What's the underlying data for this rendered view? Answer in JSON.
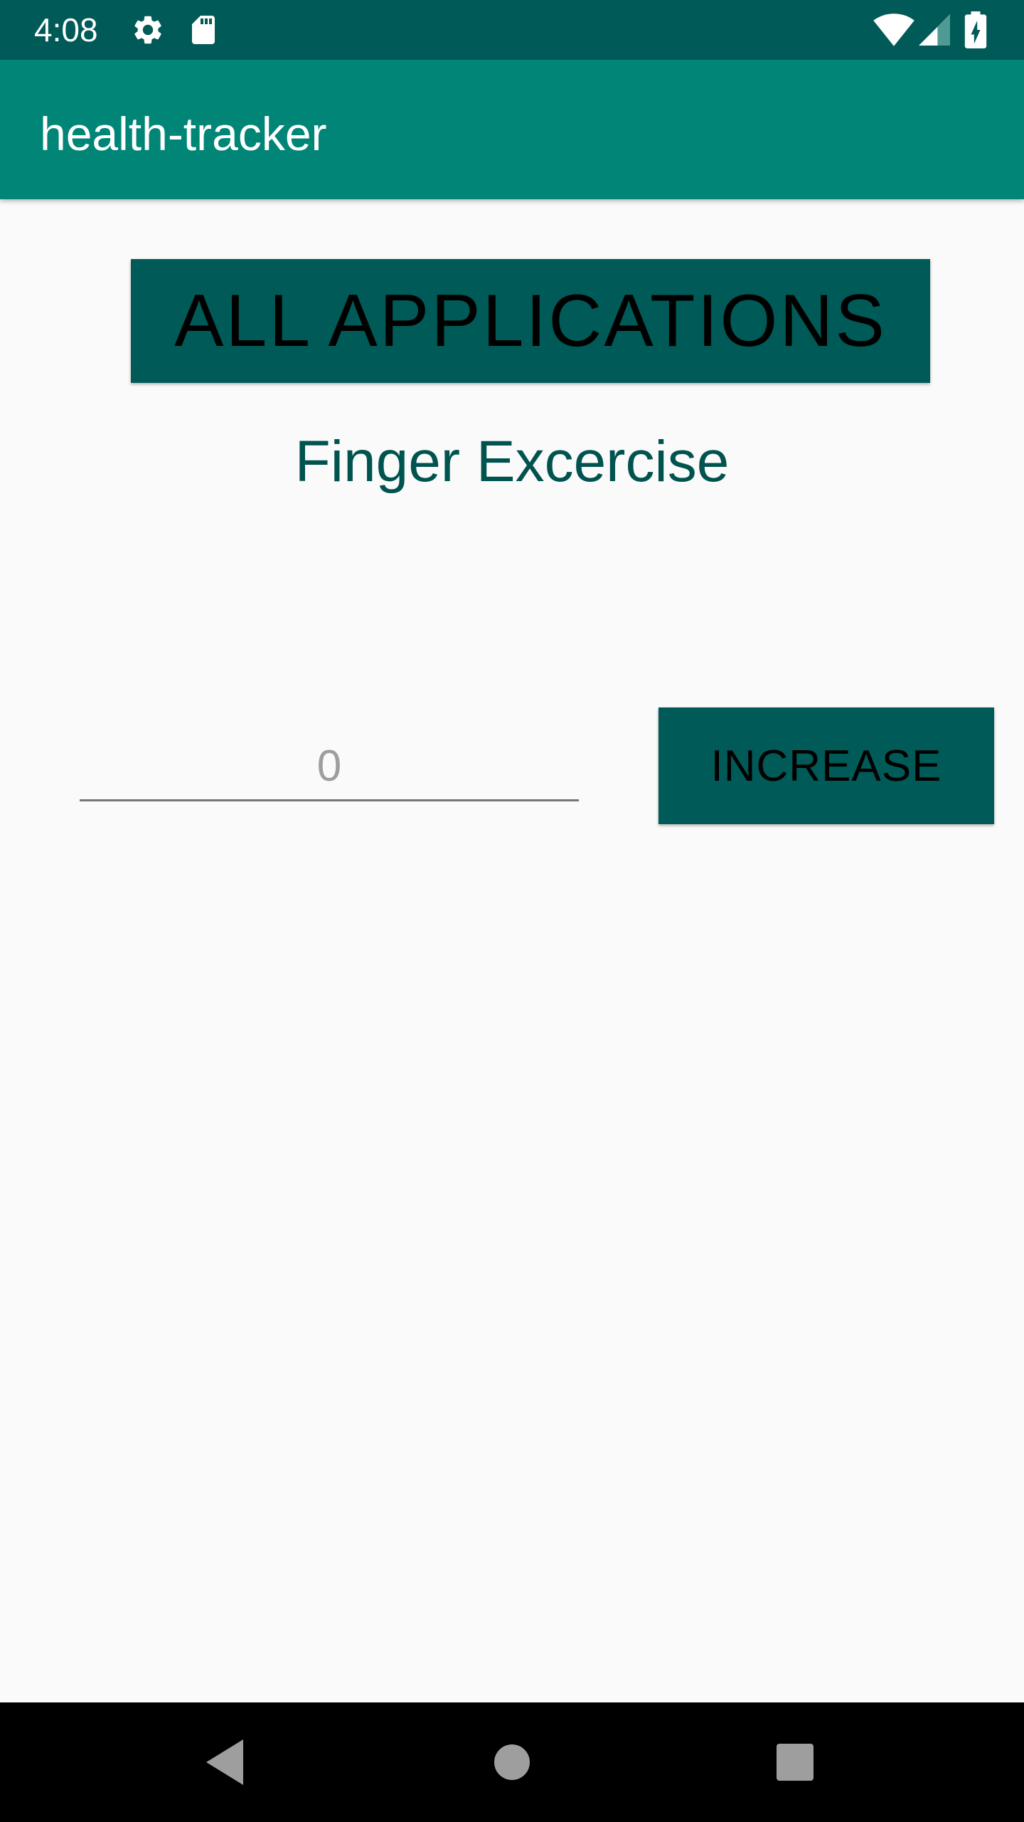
{
  "status_bar": {
    "time": "4:08",
    "icons": [
      "settings-icon",
      "sd-card-icon",
      "wifi-icon",
      "signal-icon",
      "battery-charging-icon"
    ],
    "background": "#005a57"
  },
  "app_bar": {
    "title": "health-tracker",
    "background": "#008577"
  },
  "main": {
    "all_apps_label": "ALL APPLICATIONS",
    "exercise_title": "Finger Excercise",
    "count_placeholder": "0",
    "increase_label": "INCREASE",
    "button_color": "#005a57"
  },
  "nav_bar": {
    "icons": [
      "back-icon",
      "home-icon",
      "recents-icon"
    ]
  }
}
